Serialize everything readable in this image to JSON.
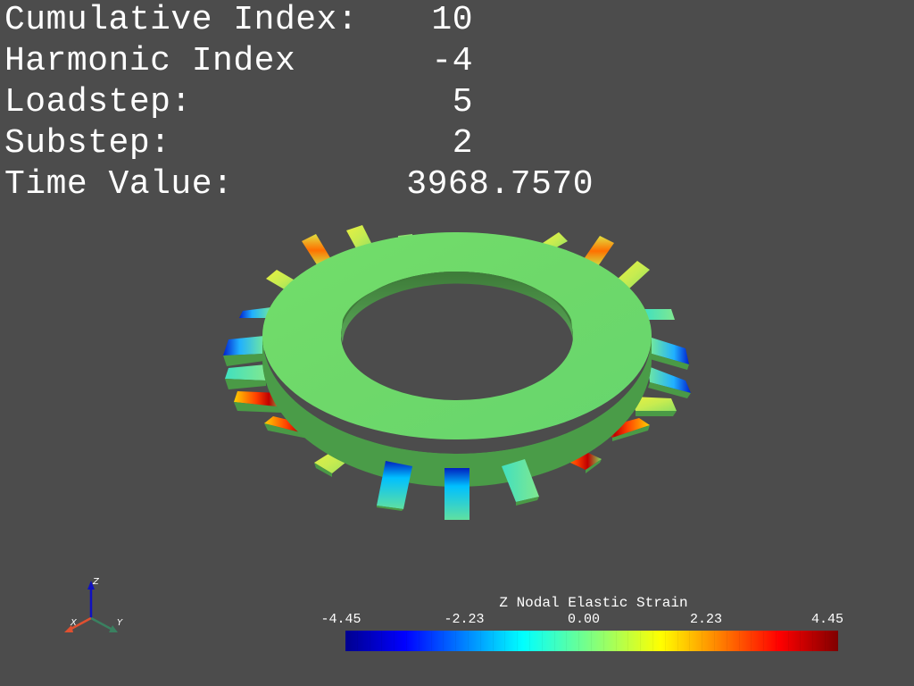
{
  "info": {
    "rows": [
      {
        "label": "Cumulative Index:",
        "value": "10"
      },
      {
        "label": "Harmonic Index",
        "value": "-4"
      },
      {
        "label": "Loadstep:",
        "value": "5"
      },
      {
        "label": "Substep:",
        "value": "2"
      },
      {
        "label": "Time Value:",
        "value": "3968.7570"
      }
    ]
  },
  "scalar_bar": {
    "title": "Z Nodal Elastic Strain",
    "ticks": [
      "-4.45",
      "-2.23",
      "0.00",
      "2.23",
      "4.45"
    ],
    "colormap": "jet",
    "range": [
      -4.45,
      4.45
    ]
  },
  "axes": {
    "x_label": "X",
    "y_label": "Y",
    "z_label": "Z",
    "x_color": "#e05030",
    "y_color": "#3a8060",
    "z_color": "#1010c0"
  },
  "model": {
    "name": "",
    "blade_count": 20,
    "base_color": "#6edc6e"
  }
}
